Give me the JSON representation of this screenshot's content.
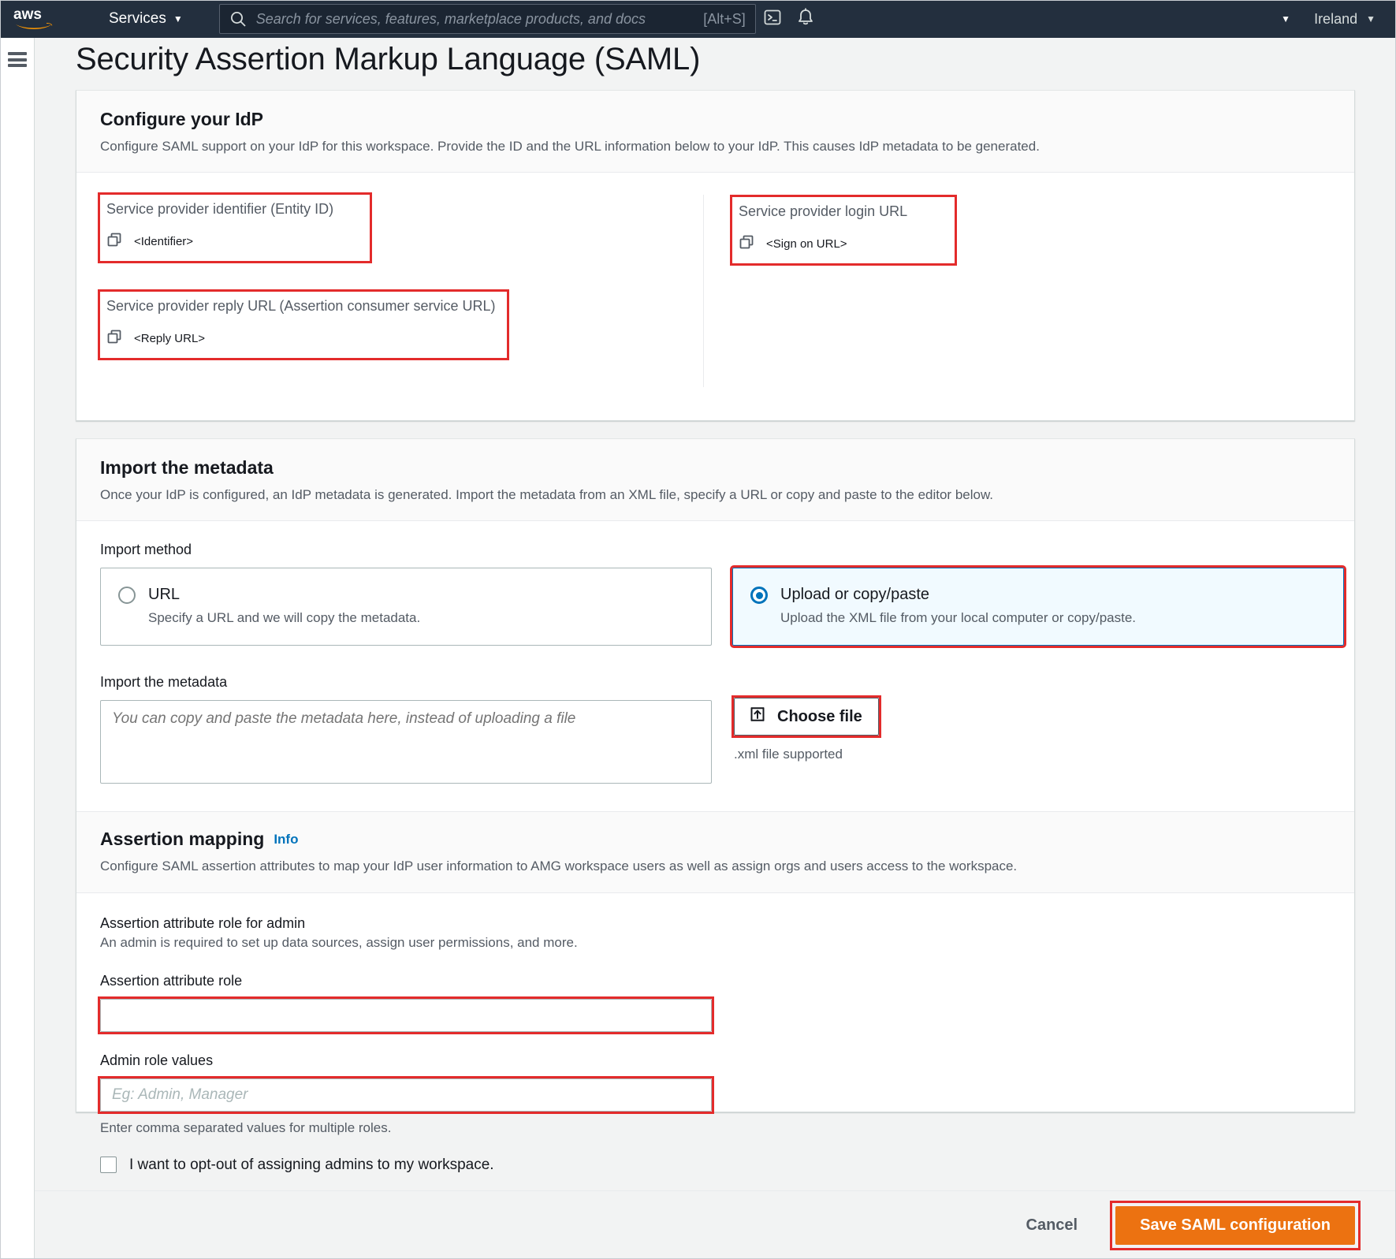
{
  "nav": {
    "logo_alt": "aws",
    "services_label": "Services",
    "search_placeholder": "Search for services, features, marketplace products, and docs",
    "search_shortcut": "[Alt+S]",
    "cloudshell_icon": "cloudshell-icon",
    "notifications_icon": "bell-icon",
    "account_caret": "▼",
    "region_label": "Ireland",
    "region_caret": "▼",
    "services_caret": "▼"
  },
  "page": {
    "title": "Security Assertion Markup Language (SAML)"
  },
  "idp_card": {
    "title": "Configure your IdP",
    "description": "Configure SAML support on your IdP for this workspace. Provide the ID and the URL information below to your IdP. This causes IdP metadata to be generated.",
    "fields": [
      {
        "label": "Service provider identifier (Entity ID)",
        "value": "<Identifier>",
        "copy_icon": "copy-icon"
      },
      {
        "label": "Service provider reply URL (Assertion consumer service URL)",
        "value": "<Reply URL>",
        "copy_icon": "copy-icon"
      },
      {
        "label": "Service provider login URL",
        "value": "<Sign on URL>",
        "copy_icon": "copy-icon"
      }
    ]
  },
  "import_card": {
    "title": "Import the metadata",
    "description": "Once your IdP is configured, an IdP metadata is generated. Import the metadata from an XML file, specify a URL or copy and paste to the editor below.",
    "import_method_label": "Import method",
    "options": [
      {
        "title": "URL",
        "subtitle": "Specify a URL and we will copy the metadata.",
        "selected": false
      },
      {
        "title": "Upload or copy/paste",
        "subtitle": "Upload the XML file from your local computer or copy/paste.",
        "selected": true
      }
    ],
    "metadata_label": "Import the metadata",
    "metadata_placeholder": "You can copy and paste the metadata here, instead of uploading a file",
    "metadata_value": "",
    "choose_file_label": "Choose file",
    "choose_file_icon": "upload-icon",
    "file_note": ".xml file supported"
  },
  "assertion_card": {
    "title": "Assertion mapping",
    "info_label": "Info",
    "description": "Configure SAML assertion attributes to map your IdP user information to AMG workspace users as well as assign orgs and users access to the workspace.",
    "admin_section_title": "Assertion attribute role for admin",
    "admin_section_desc": "An admin is required to set up data sources, assign user permissions, and more.",
    "attribute_role_label": "Assertion attribute role",
    "attribute_role_value": "",
    "attribute_role_placeholder": "",
    "admin_role_values_label": "Admin role values",
    "admin_role_values_value": "",
    "admin_role_values_placeholder": "Eg: Admin, Manager",
    "admin_role_help": "Enter comma separated values for multiple roles.",
    "optout_label": "I want to opt-out of assigning admins to my workspace.",
    "optout_checked": false
  },
  "footer": {
    "cancel_label": "Cancel",
    "save_label": "Save SAML configuration"
  },
  "colors": {
    "nav_bg": "#232f3e",
    "accent_orange": "#ec7211",
    "link_blue": "#0073bb",
    "highlight_red": "#e32b2b",
    "page_bg": "#f2f3f3"
  }
}
